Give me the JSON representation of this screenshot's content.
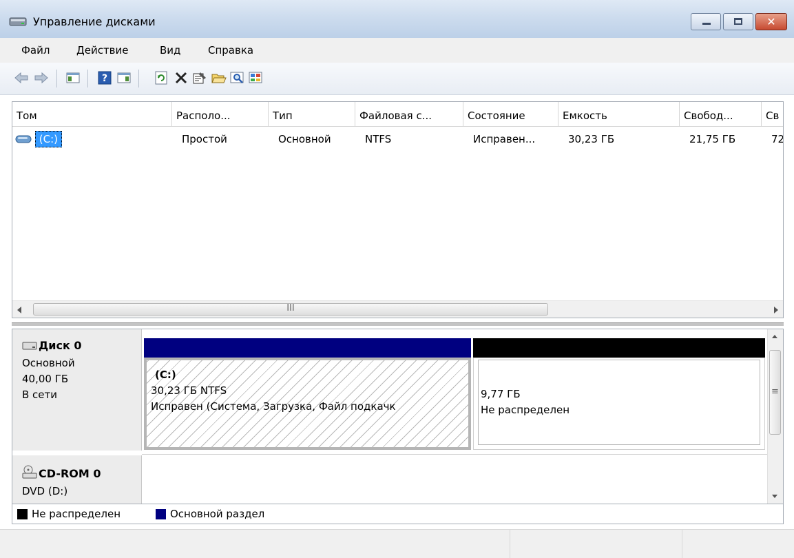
{
  "window": {
    "title": "Управление дисками",
    "controls": [
      "minimize",
      "maximize",
      "close"
    ],
    "close_glyph": "✕"
  },
  "menu": {
    "items": [
      "Файл",
      "Действие",
      "Вид",
      "Справка"
    ]
  },
  "toolbar": {
    "icons": [
      "back-arrow-icon",
      "forward-arrow-icon",
      "show-hide-console-tree-icon",
      "help-icon",
      "show-hide-action-pane-icon",
      "refresh-icon",
      "delete-icon",
      "properties-icon",
      "open-folder-icon",
      "search-icon",
      "settings-icon"
    ]
  },
  "volume_list": {
    "columns": [
      "Том",
      "Располо...",
      "Тип",
      "Файловая с...",
      "Состояние",
      "Емкость",
      "Свобод...",
      "Св"
    ],
    "rows": [
      {
        "volume": "(C:)",
        "layout": "Простой",
        "type": "Основной",
        "filesystem": "NTFS",
        "status": "Исправен...",
        "capacity": "30,23 ГБ",
        "free": "21,75 ГБ",
        "percent_free": "72"
      }
    ],
    "hscroll_grip": "III"
  },
  "disks": [
    {
      "name": "Диск 0",
      "type": "Основной",
      "size": "40,00 ГБ",
      "state": "В сети",
      "partitions": [
        {
          "label": "(C:)",
          "size_fs": "30,23 ГБ NTFS",
          "status": "Исправен (Система, Загрузка, Файл подкачк",
          "kind": "primary",
          "bar_color": "#000080"
        },
        {
          "size": "9,77 ГБ",
          "status": "Не распределен",
          "kind": "unallocated",
          "bar_color": "#000000"
        }
      ]
    },
    {
      "name": "CD-ROM 0",
      "drive": "DVD (D:)"
    }
  ],
  "vscroll_grip": "≡",
  "legend": [
    {
      "label": "Не распределен",
      "color": "#000000"
    },
    {
      "label": "Основной раздел",
      "color": "#000080"
    }
  ]
}
